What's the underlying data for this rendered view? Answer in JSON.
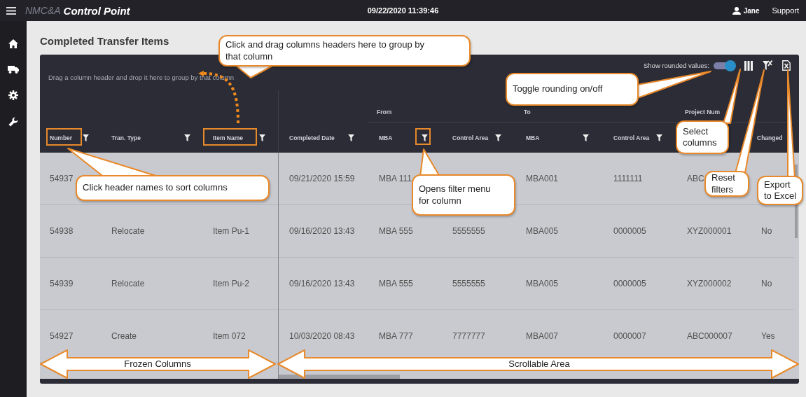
{
  "topbar": {
    "brand_prefix": "NMC&A",
    "brand_name": "Control Point",
    "datetime": "09/22/2020 11:39:46",
    "user": "Jane",
    "support_link": "Support"
  },
  "page_title": "Completed Transfer Items",
  "grid": {
    "group_panel_hint": "Drag a column header and drop it here to group by that column",
    "rounding": {
      "label": "Show rounded values:",
      "on": true
    },
    "column_bands": [
      {
        "label": "From"
      },
      {
        "label": "To"
      },
      {
        "label": "Project Num"
      }
    ],
    "frozen_columns": [
      {
        "label": "Number",
        "filter": true
      },
      {
        "label": "Tran. Type",
        "filter": true
      },
      {
        "label": "Item Name",
        "filter": true
      }
    ],
    "scroll_columns": [
      {
        "label": "Completed Date",
        "filter": true
      },
      {
        "label": "MBA",
        "filter": true
      },
      {
        "label": "Control Area",
        "filter": true
      },
      {
        "label": "MBA",
        "filter": true
      },
      {
        "label": "Control Area",
        "filter": true
      },
      {},
      {
        "label": "Changed"
      }
    ],
    "rows": [
      {
        "cells": [
          "54937",
          null,
          null,
          "09/21/2020 15:59",
          "MBA 111",
          null,
          "MBA001",
          "1111111",
          "ABC",
          null
        ]
      },
      {
        "cells": [
          "54938",
          "Relocate",
          "Item Pu-1",
          "09/16/2020 13:43",
          "MBA 555",
          "5555555",
          "MBA005",
          "0000005",
          "XYZ000001",
          "No"
        ]
      },
      {
        "cells": [
          "54939",
          "Relocate",
          "Item Pu-2",
          "09/16/2020 13:43",
          "MBA 555",
          "5555555",
          "MBA005",
          "0000005",
          "XYZ000002",
          "No"
        ]
      },
      {
        "cells": [
          "54927",
          "Create",
          "Item 072",
          "10/03/2020 08:43",
          "MBA 777",
          "7777777",
          "MBA007",
          "0000007",
          "ABC000007",
          "Yes"
        ]
      }
    ]
  },
  "annotations": {
    "callouts": [
      {
        "text": "Click and drag columns headers here to group by that column"
      },
      {
        "text": "Click header names to sort columns"
      },
      {
        "text": "Opens filter menu for column"
      },
      {
        "text": "Toggle rounding on/off"
      },
      {
        "text": "Select columns"
      },
      {
        "text": "Reset filters"
      },
      {
        "text": "Export to Excel"
      }
    ],
    "arrows": [
      {
        "label": "Frozen Columns"
      },
      {
        "label": "Scrollable Area"
      }
    ]
  }
}
